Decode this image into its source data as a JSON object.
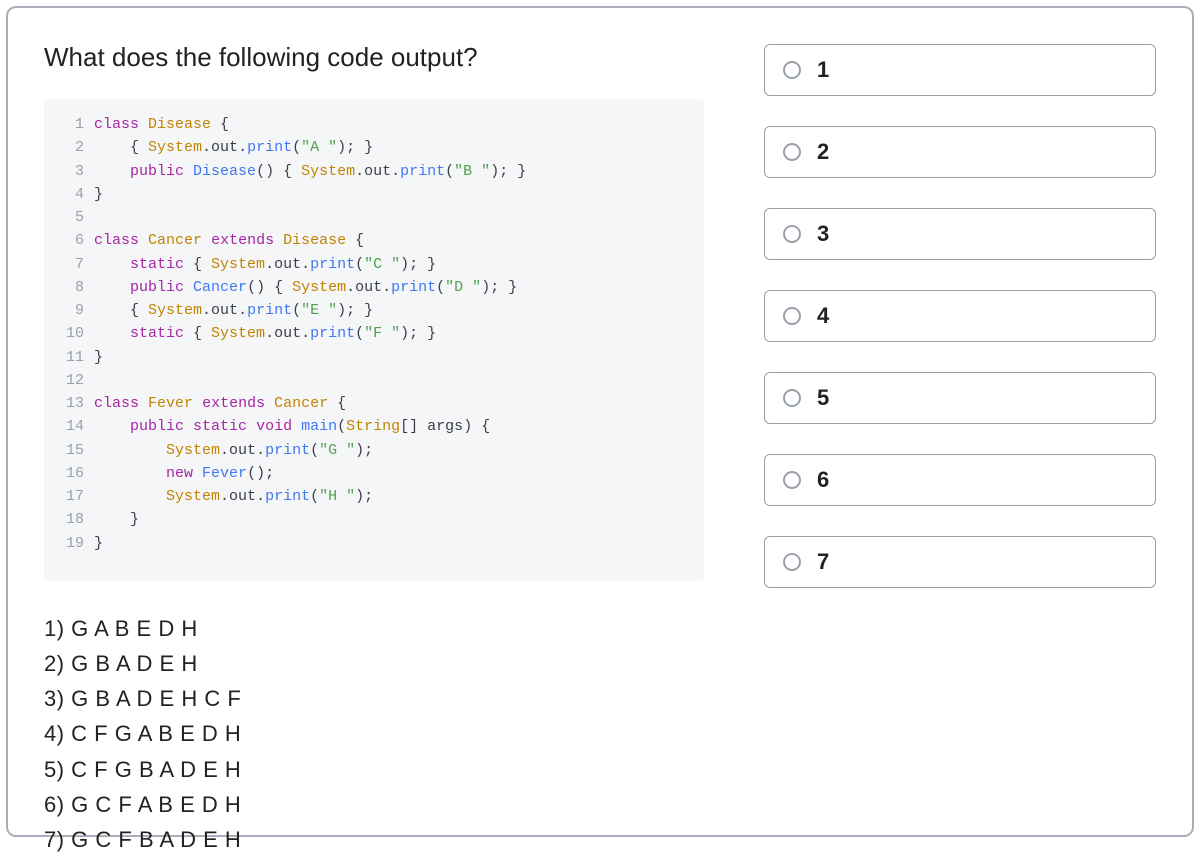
{
  "question": "What does the following code output?",
  "code_lines": [
    [
      {
        "t": "kw",
        "v": "class"
      },
      {
        "t": "tok",
        "v": " "
      },
      {
        "t": "type",
        "v": "Disease"
      },
      {
        "t": "tok",
        "v": " {"
      }
    ],
    [
      {
        "t": "tok",
        "v": "    { "
      },
      {
        "t": "type",
        "v": "System"
      },
      {
        "t": "punct",
        "v": "."
      },
      {
        "t": "tok",
        "v": "out"
      },
      {
        "t": "punct",
        "v": "."
      },
      {
        "t": "fn",
        "v": "print"
      },
      {
        "t": "punct",
        "v": "("
      },
      {
        "t": "str",
        "v": "\"A \""
      },
      {
        "t": "punct",
        "v": "); }"
      }
    ],
    [
      {
        "t": "tok",
        "v": "    "
      },
      {
        "t": "kw",
        "v": "public"
      },
      {
        "t": "tok",
        "v": " "
      },
      {
        "t": "fn",
        "v": "Disease"
      },
      {
        "t": "punct",
        "v": "() { "
      },
      {
        "t": "type",
        "v": "System"
      },
      {
        "t": "punct",
        "v": "."
      },
      {
        "t": "tok",
        "v": "out"
      },
      {
        "t": "punct",
        "v": "."
      },
      {
        "t": "fn",
        "v": "print"
      },
      {
        "t": "punct",
        "v": "("
      },
      {
        "t": "str",
        "v": "\"B \""
      },
      {
        "t": "punct",
        "v": "); }"
      }
    ],
    [
      {
        "t": "tok",
        "v": "}"
      }
    ],
    [
      {
        "t": "tok",
        "v": ""
      }
    ],
    [
      {
        "t": "kw",
        "v": "class"
      },
      {
        "t": "tok",
        "v": " "
      },
      {
        "t": "type",
        "v": "Cancer"
      },
      {
        "t": "tok",
        "v": " "
      },
      {
        "t": "kw",
        "v": "extends"
      },
      {
        "t": "tok",
        "v": " "
      },
      {
        "t": "type",
        "v": "Disease"
      },
      {
        "t": "tok",
        "v": " {"
      }
    ],
    [
      {
        "t": "tok",
        "v": "    "
      },
      {
        "t": "kw",
        "v": "static"
      },
      {
        "t": "tok",
        "v": " { "
      },
      {
        "t": "type",
        "v": "System"
      },
      {
        "t": "punct",
        "v": "."
      },
      {
        "t": "tok",
        "v": "out"
      },
      {
        "t": "punct",
        "v": "."
      },
      {
        "t": "fn",
        "v": "print"
      },
      {
        "t": "punct",
        "v": "("
      },
      {
        "t": "str",
        "v": "\"C \""
      },
      {
        "t": "punct",
        "v": "); }"
      }
    ],
    [
      {
        "t": "tok",
        "v": "    "
      },
      {
        "t": "kw",
        "v": "public"
      },
      {
        "t": "tok",
        "v": " "
      },
      {
        "t": "fn",
        "v": "Cancer"
      },
      {
        "t": "punct",
        "v": "() { "
      },
      {
        "t": "type",
        "v": "System"
      },
      {
        "t": "punct",
        "v": "."
      },
      {
        "t": "tok",
        "v": "out"
      },
      {
        "t": "punct",
        "v": "."
      },
      {
        "t": "fn",
        "v": "print"
      },
      {
        "t": "punct",
        "v": "("
      },
      {
        "t": "str",
        "v": "\"D \""
      },
      {
        "t": "punct",
        "v": "); }"
      }
    ],
    [
      {
        "t": "tok",
        "v": "    { "
      },
      {
        "t": "type",
        "v": "System"
      },
      {
        "t": "punct",
        "v": "."
      },
      {
        "t": "tok",
        "v": "out"
      },
      {
        "t": "punct",
        "v": "."
      },
      {
        "t": "fn",
        "v": "print"
      },
      {
        "t": "punct",
        "v": "("
      },
      {
        "t": "str",
        "v": "\"E \""
      },
      {
        "t": "punct",
        "v": "); }"
      }
    ],
    [
      {
        "t": "tok",
        "v": "    "
      },
      {
        "t": "kw",
        "v": "static"
      },
      {
        "t": "tok",
        "v": " { "
      },
      {
        "t": "type",
        "v": "System"
      },
      {
        "t": "punct",
        "v": "."
      },
      {
        "t": "tok",
        "v": "out"
      },
      {
        "t": "punct",
        "v": "."
      },
      {
        "t": "fn",
        "v": "print"
      },
      {
        "t": "punct",
        "v": "("
      },
      {
        "t": "str",
        "v": "\"F \""
      },
      {
        "t": "punct",
        "v": "); }"
      }
    ],
    [
      {
        "t": "tok",
        "v": "}"
      }
    ],
    [
      {
        "t": "tok",
        "v": ""
      }
    ],
    [
      {
        "t": "kw",
        "v": "class"
      },
      {
        "t": "tok",
        "v": " "
      },
      {
        "t": "type",
        "v": "Fever"
      },
      {
        "t": "tok",
        "v": " "
      },
      {
        "t": "kw",
        "v": "extends"
      },
      {
        "t": "tok",
        "v": " "
      },
      {
        "t": "type",
        "v": "Cancer"
      },
      {
        "t": "tok",
        "v": " {"
      }
    ],
    [
      {
        "t": "tok",
        "v": "    "
      },
      {
        "t": "kw",
        "v": "public"
      },
      {
        "t": "tok",
        "v": " "
      },
      {
        "t": "kw",
        "v": "static"
      },
      {
        "t": "tok",
        "v": " "
      },
      {
        "t": "kw",
        "v": "void"
      },
      {
        "t": "tok",
        "v": " "
      },
      {
        "t": "fn",
        "v": "main"
      },
      {
        "t": "punct",
        "v": "("
      },
      {
        "t": "type",
        "v": "String"
      },
      {
        "t": "punct",
        "v": "[] "
      },
      {
        "t": "tok",
        "v": "args"
      },
      {
        "t": "punct",
        "v": ") {"
      }
    ],
    [
      {
        "t": "tok",
        "v": "        "
      },
      {
        "t": "type",
        "v": "System"
      },
      {
        "t": "punct",
        "v": "."
      },
      {
        "t": "tok",
        "v": "out"
      },
      {
        "t": "punct",
        "v": "."
      },
      {
        "t": "fn",
        "v": "print"
      },
      {
        "t": "punct",
        "v": "("
      },
      {
        "t": "str",
        "v": "\"G \""
      },
      {
        "t": "punct",
        "v": ");"
      }
    ],
    [
      {
        "t": "tok",
        "v": "        "
      },
      {
        "t": "kw",
        "v": "new"
      },
      {
        "t": "tok",
        "v": " "
      },
      {
        "t": "fn",
        "v": "Fever"
      },
      {
        "t": "punct",
        "v": "();"
      }
    ],
    [
      {
        "t": "tok",
        "v": "        "
      },
      {
        "t": "type",
        "v": "System"
      },
      {
        "t": "punct",
        "v": "."
      },
      {
        "t": "tok",
        "v": "out"
      },
      {
        "t": "punct",
        "v": "."
      },
      {
        "t": "fn",
        "v": "print"
      },
      {
        "t": "punct",
        "v": "("
      },
      {
        "t": "str",
        "v": "\"H \""
      },
      {
        "t": "punct",
        "v": ");"
      }
    ],
    [
      {
        "t": "tok",
        "v": "    }"
      }
    ],
    [
      {
        "t": "tok",
        "v": "}"
      }
    ]
  ],
  "answer_rows": [
    "1) G A B E D H",
    "2) G B A D E H",
    "3) G B A D E H C F",
    "4) C F G A B E D H",
    "5) C F G B A D E H",
    "6) G C F A B E D H",
    "7) G C F B A D E H"
  ],
  "options": [
    "1",
    "2",
    "3",
    "4",
    "5",
    "6",
    "7"
  ]
}
